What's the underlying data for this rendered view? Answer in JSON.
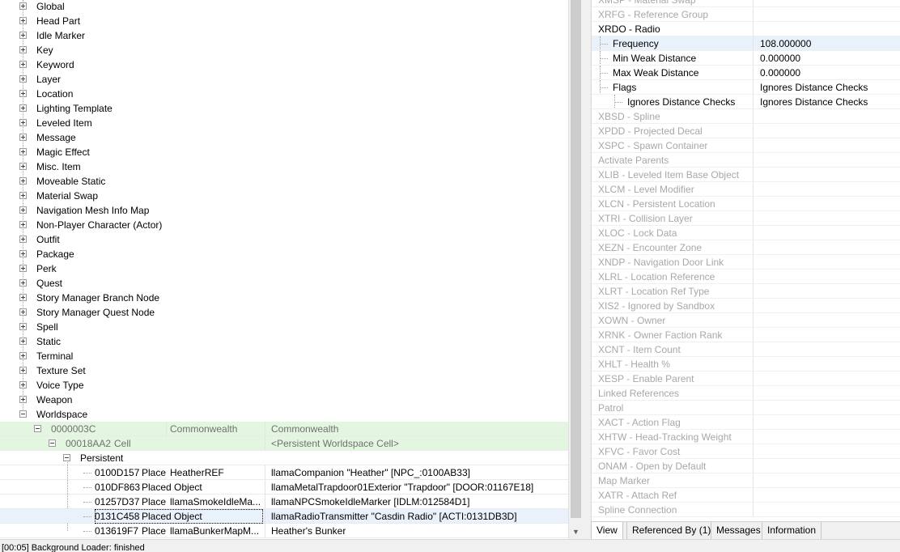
{
  "tree": {
    "categories": [
      "Global",
      "Head Part",
      "Idle Marker",
      "Key",
      "Keyword",
      "Layer",
      "Location",
      "Lighting Template",
      "Leveled Item",
      "Message",
      "Magic Effect",
      "Misc. Item",
      "Moveable Static",
      "Material Swap",
      "Navigation Mesh Info Map",
      "Non-Player Character (Actor)",
      "Outfit",
      "Package",
      "Perk",
      "Quest",
      "Story Manager Branch Node",
      "Story Manager Quest Node",
      "Spell",
      "Static",
      "Terminal",
      "Texture Set",
      "Voice Type",
      "Weapon",
      "Worldspace"
    ],
    "worldspace_row": {
      "id": "0000003C",
      "editor_id": "Commonwealth",
      "name": "Commonwealth"
    },
    "cell_row": {
      "id": "00018AA2",
      "type": "Cell",
      "name": "<Persistent Worldspace Cell>"
    },
    "persistent_label": "Persistent",
    "refs": [
      {
        "id": "0100D157",
        "type": "Place",
        "name": "HeatherREF",
        "desc": "llamaCompanion \"Heather\" [NPC_:0100AB33]"
      },
      {
        "id": "010DF863",
        "type": "Placed Object",
        "name": "",
        "desc": "llamaMetalTrapdoor01Exterior \"Trapdoor\" [DOOR:01167E18]"
      },
      {
        "id": "01257D37",
        "type": "Place",
        "name": "llamaSmokeIdleMa...",
        "desc": "llamaNPCSmokeIdleMarker [IDLM:012584D1]"
      },
      {
        "id": "0131C458",
        "type": "Placed Object",
        "name": "",
        "desc": "llamaRadioTransmitter \"Casdin Radio\" [ACTI:0131DB3D]"
      },
      {
        "id": "013619F7",
        "type": "Place",
        "name": "llamaBunkerMapM...",
        "desc": "Heather's Bunker"
      }
    ]
  },
  "properties": {
    "rows": [
      {
        "name": "XMSP - Material Swap",
        "value": "",
        "indent": 0,
        "disabled": true
      },
      {
        "name": "XRFG - Reference Group",
        "value": "",
        "indent": 0,
        "disabled": true
      },
      {
        "name": "XRDO - Radio",
        "value": "",
        "indent": 0,
        "disabled": false
      },
      {
        "name": "Frequency",
        "value": "108.000000",
        "indent": 1,
        "disabled": false,
        "highlight": true
      },
      {
        "name": "Min Weak Distance",
        "value": "0.000000",
        "indent": 1,
        "disabled": false
      },
      {
        "name": "Max Weak Distance",
        "value": "0.000000",
        "indent": 1,
        "disabled": false
      },
      {
        "name": "Flags",
        "value": "Ignores Distance Checks",
        "indent": 1,
        "disabled": false
      },
      {
        "name": "Ignores Distance Checks",
        "value": "Ignores Distance Checks",
        "indent": 2,
        "disabled": false
      },
      {
        "name": "XBSD - Spline",
        "value": "",
        "indent": 0,
        "disabled": true
      },
      {
        "name": "XPDD - Projected Decal",
        "value": "",
        "indent": 0,
        "disabled": true
      },
      {
        "name": "XSPC - Spawn Container",
        "value": "",
        "indent": 0,
        "disabled": true
      },
      {
        "name": "Activate Parents",
        "value": "",
        "indent": 0,
        "disabled": true
      },
      {
        "name": "XLIB - Leveled Item Base Object",
        "value": "",
        "indent": 0,
        "disabled": true
      },
      {
        "name": "XLCM - Level Modifier",
        "value": "",
        "indent": 0,
        "disabled": true
      },
      {
        "name": "XLCN - Persistent Location",
        "value": "",
        "indent": 0,
        "disabled": true
      },
      {
        "name": "XTRI - Collision Layer",
        "value": "",
        "indent": 0,
        "disabled": true
      },
      {
        "name": "XLOC - Lock Data",
        "value": "",
        "indent": 0,
        "disabled": true
      },
      {
        "name": "XEZN - Encounter Zone",
        "value": "",
        "indent": 0,
        "disabled": true
      },
      {
        "name": "XNDP - Navigation Door Link",
        "value": "",
        "indent": 0,
        "disabled": true
      },
      {
        "name": "XLRL - Location Reference",
        "value": "",
        "indent": 0,
        "disabled": true
      },
      {
        "name": "XLRT - Location Ref Type",
        "value": "",
        "indent": 0,
        "disabled": true
      },
      {
        "name": "XIS2 - Ignored by Sandbox",
        "value": "",
        "indent": 0,
        "disabled": true
      },
      {
        "name": "XOWN - Owner",
        "value": "",
        "indent": 0,
        "disabled": true
      },
      {
        "name": "XRNK - Owner Faction Rank",
        "value": "",
        "indent": 0,
        "disabled": true
      },
      {
        "name": "XCNT - Item Count",
        "value": "",
        "indent": 0,
        "disabled": true
      },
      {
        "name": "XHLT - Health %",
        "value": "",
        "indent": 0,
        "disabled": true
      },
      {
        "name": "XESP - Enable Parent",
        "value": "",
        "indent": 0,
        "disabled": true
      },
      {
        "name": "Linked References",
        "value": "",
        "indent": 0,
        "disabled": true
      },
      {
        "name": "Patrol",
        "value": "",
        "indent": 0,
        "disabled": true
      },
      {
        "name": "XACT - Action Flag",
        "value": "",
        "indent": 0,
        "disabled": true
      },
      {
        "name": "XHTW - Head-Tracking Weight",
        "value": "",
        "indent": 0,
        "disabled": true
      },
      {
        "name": "XFVC - Favor Cost",
        "value": "",
        "indent": 0,
        "disabled": true
      },
      {
        "name": "ONAM - Open by Default",
        "value": "",
        "indent": 0,
        "disabled": true
      },
      {
        "name": "Map Marker",
        "value": "",
        "indent": 0,
        "disabled": true
      },
      {
        "name": "XATR - Attach Ref",
        "value": "",
        "indent": 0,
        "disabled": true
      },
      {
        "name": "Spline Connection",
        "value": "",
        "indent": 0,
        "disabled": true
      }
    ]
  },
  "tabs": [
    "View",
    "Referenced By (1)",
    "Messages",
    "Information"
  ],
  "status": {
    "text": "[00:05] Background Loader: finished"
  }
}
